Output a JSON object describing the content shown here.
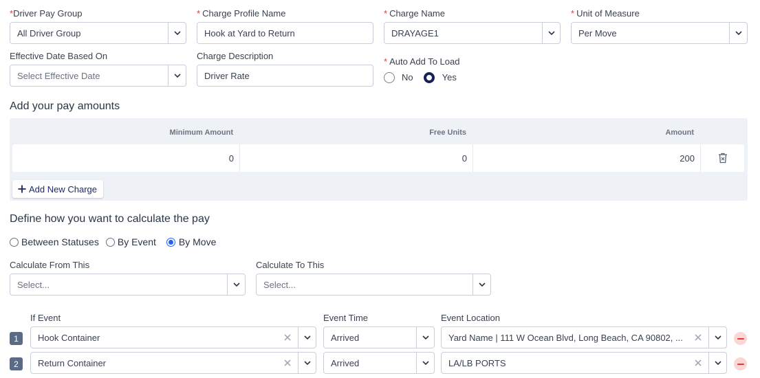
{
  "form": {
    "driver_pay_group": {
      "label": "Driver Pay Group",
      "value": "All Driver Group"
    },
    "charge_profile_name": {
      "label": "Charge Profile Name",
      "value": "Hook at Yard to Return"
    },
    "charge_name": {
      "label": "Charge Name",
      "value": "DRAYAGE1"
    },
    "unit_of_measure": {
      "label": "Unit of Measure",
      "value": "Per Move"
    },
    "effective_date": {
      "label": "Effective Date Based On",
      "placeholder": "Select Effective Date"
    },
    "charge_description": {
      "label": "Charge Description",
      "value": "Driver Rate"
    },
    "auto_add": {
      "label": "Auto Add To Load",
      "options": [
        "No",
        "Yes"
      ],
      "selected": "Yes"
    },
    "required_marker": "*"
  },
  "pay_amounts": {
    "title": "Add your pay amounts",
    "columns": [
      "Minimum Amount",
      "Free Units",
      "Amount"
    ],
    "rows": [
      {
        "minimum_amount": "0",
        "free_units": "0",
        "amount": "200"
      }
    ],
    "add_button": "Add New Charge"
  },
  "calculation": {
    "title": "Define how you want to calculate the pay",
    "modes": [
      "Between Statuses",
      "By Event",
      "By Move"
    ],
    "selected_mode": "By Move",
    "calc_from": {
      "label": "Calculate From This",
      "placeholder": "Select..."
    },
    "calc_to": {
      "label": "Calculate To This",
      "placeholder": "Select..."
    }
  },
  "events": {
    "headers": {
      "event": "If Event",
      "time": "Event Time",
      "location": "Event Location"
    },
    "rows": [
      {
        "index": "1",
        "event": "Hook Container",
        "time": "Arrived",
        "location": "Yard Name | 111 W Ocean Blvd, Long Beach, CA 90802, ..."
      },
      {
        "index": "2",
        "event": "Return Container",
        "time": "Arrived",
        "location": "LA/LB PORTS"
      }
    ]
  },
  "icons": {
    "caret": "chevron-down-icon",
    "clear": "close-icon",
    "delete": "trash-icon",
    "add": "plus-icon",
    "remove": "minus-circle-icon"
  },
  "colors": {
    "required": "#e23b3b",
    "primary_navy": "#16215a",
    "radio_blue": "#2563eb",
    "remove_red": "#e0393e",
    "remove_bg": "#fcd5d5",
    "pay_box_bg": "#eef1f5",
    "badge_bg": "#5b6b86"
  }
}
